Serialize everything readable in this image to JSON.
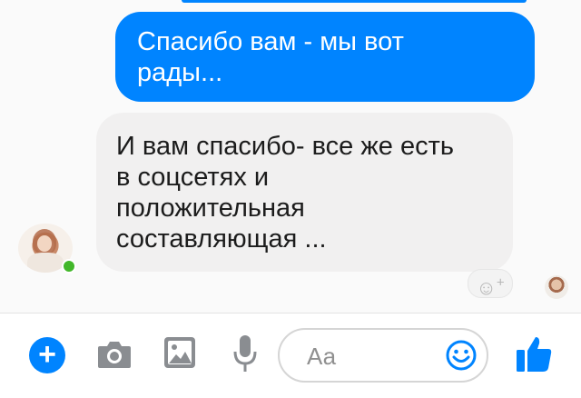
{
  "conversation": {
    "messages": [
      {
        "sender": "me",
        "text": "Спасибо вам - мы вот\nрады..."
      },
      {
        "sender": "contact",
        "text": "И вам спасибо- все же есть\nв соцсетях и\nположительная\nсоставляющая ..."
      }
    ],
    "contact_online": true
  },
  "reaction": {
    "icon": "smiley-add-icon"
  },
  "composer": {
    "placeholder": "Аа",
    "icons": [
      "plus-icon",
      "camera-icon",
      "image-icon",
      "microphone-icon",
      "emoji-icon",
      "thumbs-up-icon"
    ]
  },
  "colors": {
    "accent": "#0084ff",
    "incoming_bubble": "#f1f0f0",
    "online": "#42b72a"
  }
}
